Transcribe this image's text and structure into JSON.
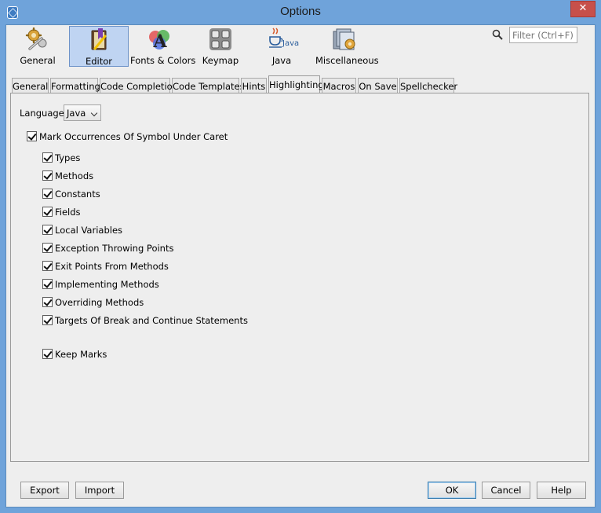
{
  "window": {
    "title": "Options",
    "close_glyph": "✕"
  },
  "categories": [
    {
      "label": "General",
      "icon": "gears-wrench-icon",
      "selected": false
    },
    {
      "label": "Editor",
      "icon": "editor-book-icon",
      "selected": true
    },
    {
      "label": "Fonts & Colors",
      "icon": "fonts-colors-icon",
      "selected": false
    },
    {
      "label": "Keymap",
      "icon": "keymap-icon",
      "selected": false
    },
    {
      "label": "Java",
      "icon": "java-icon",
      "selected": false
    },
    {
      "label": "Miscellaneous",
      "icon": "miscellaneous-icon",
      "selected": false
    }
  ],
  "search": {
    "placeholder": "Filter (Ctrl+F)",
    "icon": "magnifier-icon"
  },
  "tabs": [
    {
      "label": "General",
      "active": false
    },
    {
      "label": "Formatting",
      "active": false
    },
    {
      "label": "Code Completion",
      "active": false
    },
    {
      "label": "Code Templates",
      "active": false
    },
    {
      "label": "Hints",
      "active": false
    },
    {
      "label": "Highlighting",
      "active": true
    },
    {
      "label": "Macros",
      "active": false
    },
    {
      "label": "On Save",
      "active": false
    },
    {
      "label": "Spellchecker",
      "active": false
    }
  ],
  "highlighting": {
    "language_label": "Language:",
    "language_value": "Java",
    "mark_occurrences": {
      "label": "Mark Occurrences Of Symbol Under Caret",
      "checked": true
    },
    "options": [
      {
        "label": "Types",
        "checked": true
      },
      {
        "label": "Methods",
        "checked": true
      },
      {
        "label": "Constants",
        "checked": true
      },
      {
        "label": "Fields",
        "checked": true
      },
      {
        "label": "Local Variables",
        "checked": true
      },
      {
        "label": "Exception Throwing Points",
        "checked": true
      },
      {
        "label": "Exit Points From Methods",
        "checked": true
      },
      {
        "label": "Implementing Methods",
        "checked": true
      },
      {
        "label": "Overriding Methods",
        "checked": true
      },
      {
        "label": "Targets Of Break and Continue Statements",
        "checked": true
      }
    ],
    "keep_marks": {
      "label": "Keep Marks",
      "checked": true
    }
  },
  "buttons": {
    "export": "Export",
    "import": "Import",
    "ok": "OK",
    "cancel": "Cancel",
    "help": "Help"
  },
  "colors": {
    "title_bar": "#6fa3da",
    "close_button": "#c7504b",
    "selected_category": "#bfd4f2"
  }
}
